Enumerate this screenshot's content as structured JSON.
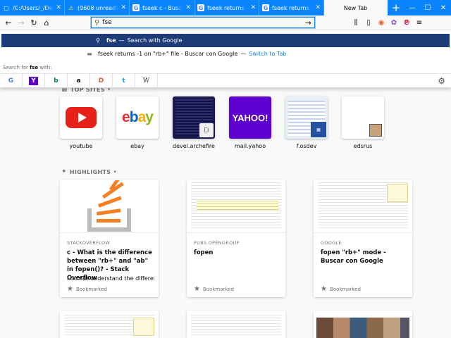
{
  "tabs": [
    {
      "label": "/C:/Users/_/Desktop/_",
      "icon": "page-icon",
      "active": false
    },
    {
      "label": "(9608 unread) – Ya",
      "icon": "warning-icon",
      "active": false
    },
    {
      "label": "fseek c - Buscar con",
      "icon": "google-icon",
      "active": false
    },
    {
      "label": "fseek returns -1 on",
      "icon": "google-icon",
      "active": false
    },
    {
      "label": "fseek returns -1 on",
      "icon": "google-icon",
      "active": false
    },
    {
      "label": "New Tab",
      "icon": "",
      "active": true
    }
  ],
  "navbar": {
    "url_value": "fse"
  },
  "popup": {
    "suggestion_text": "fse",
    "suggestion_action": "Search with Google",
    "tab_suggestion_title": "fseek returns -1 on \"rb+\" file - Buscar con Google",
    "tab_suggestion_action": "Switch to Tab",
    "search_for_prefix": "Search for",
    "search_for_term": "fse",
    "search_for_suffix": "with:",
    "engines": [
      {
        "label": "G",
        "icon": "google-icon",
        "color": "#4285f4"
      },
      {
        "label": "Y",
        "icon": "yahoo-icon",
        "color": "#5f01d1"
      },
      {
        "label": "b",
        "icon": "bing-icon",
        "color": "#008373"
      },
      {
        "label": "a",
        "icon": "amazon-icon",
        "color": "#111111"
      },
      {
        "label": "D",
        "icon": "duckduckgo-icon",
        "color": "#de5833"
      },
      {
        "label": "t",
        "icon": "twitter-icon",
        "color": "#1da1f2"
      },
      {
        "label": "W",
        "icon": "wikipedia-icon",
        "color": "#333333"
      }
    ]
  },
  "topsites": {
    "title": "TOP SITES",
    "sites": [
      {
        "label": "youtube"
      },
      {
        "label": "ebay"
      },
      {
        "label": "devel.archefire",
        "badge": "D"
      },
      {
        "label": "mail.yahoo",
        "logo": "YAHOO!"
      },
      {
        "label": "f.osdev"
      },
      {
        "label": "edsrus"
      }
    ]
  },
  "highlights": {
    "title": "HIGHLIGHTS",
    "cards": [
      {
        "source": "STACKOVERFLOW",
        "title": "c - What is the difference between \"rb+\" and \"ab\" in fopen()? - Stack Overflow",
        "description": "I do not understand the difference",
        "footer": "Bookmarked"
      },
      {
        "source": "PUBS.OPENGROUP",
        "title": "fopen",
        "description": "",
        "footer": "Bookmarked"
      },
      {
        "source": "GOOGLE",
        "title": "fopen \"rb+\" mode - Buscar con Google",
        "description": "",
        "footer": "Bookmarked"
      }
    ]
  },
  "colors": {
    "accent": "#0a84ff",
    "selected_row": "#1d3c78",
    "stackoverflow_orange": "#f48024",
    "youtube_red": "#e62117",
    "yahoo_purple": "#5f01d1"
  }
}
